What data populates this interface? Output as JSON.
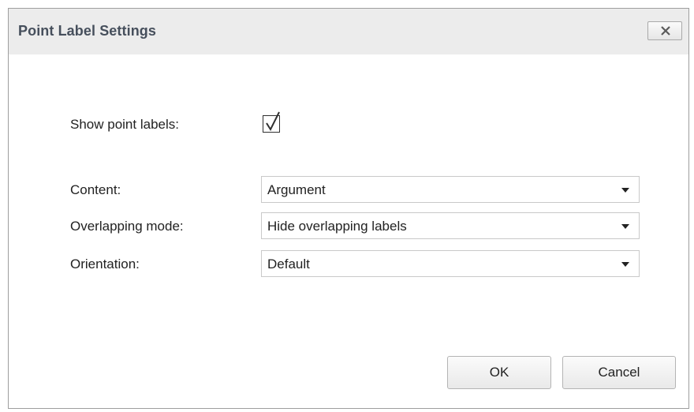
{
  "dialog": {
    "title": "Point Label Settings"
  },
  "form": {
    "show_labels": {
      "label": "Show point labels:",
      "checked": true
    },
    "content": {
      "label": "Content:",
      "value": "Argument"
    },
    "overlapping_mode": {
      "label": "Overlapping mode:",
      "value": "Hide overlapping labels"
    },
    "orientation": {
      "label": "Orientation:",
      "value": "Default"
    }
  },
  "buttons": {
    "ok": "OK",
    "cancel": "Cancel"
  },
  "icons": {
    "close": "close-icon",
    "check": "checkmark-icon",
    "dropdown": "chevron-down-icon"
  }
}
